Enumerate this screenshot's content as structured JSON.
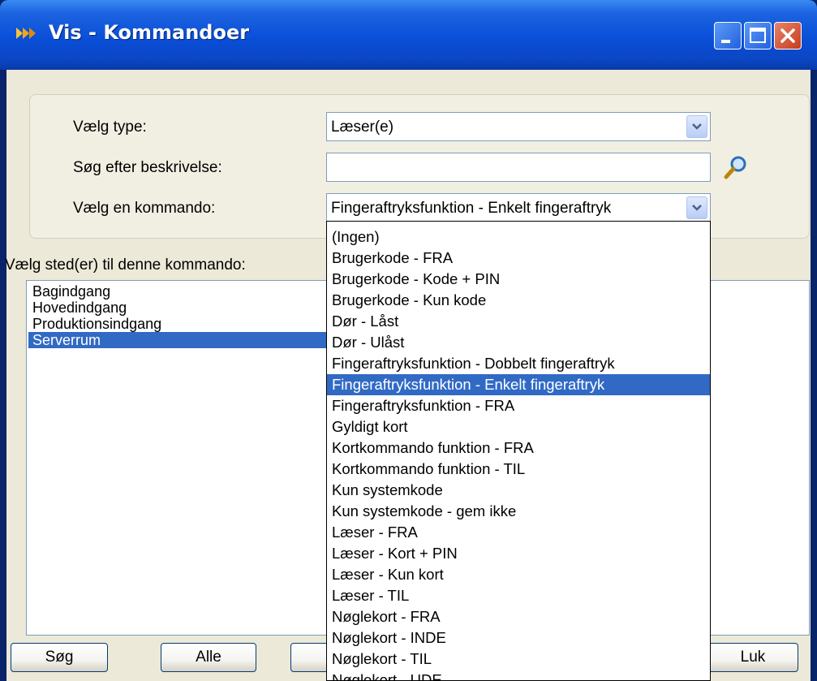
{
  "window": {
    "title": "Vis - Kommandoer",
    "buttons": [
      "minimize",
      "maximize",
      "close"
    ]
  },
  "filters": {
    "type_label": "Vælg type:",
    "type_value": "Læser(e)",
    "search_label": "Søg efter beskrivelse:",
    "search_value": "",
    "command_label": "Vælg en kommando:",
    "command_value": "Fingeraftryksfunktion - Enkelt fingeraftryk"
  },
  "locations": {
    "label": "Vælg sted(er) til denne kommando:",
    "items": [
      "Bagindgang",
      "Hovedindgang",
      "Produktionsindgang",
      "Serverrum"
    ],
    "selected_index": 3
  },
  "command_options": [
    "(Ingen)",
    "Brugerkode - FRA",
    "Brugerkode - Kode + PIN",
    "Brugerkode - Kun kode",
    "Dør - Låst",
    "Dør - Ulåst",
    "Fingeraftryksfunktion - Dobbelt fingeraftryk",
    "Fingeraftryksfunktion - Enkelt fingeraftryk",
    "Fingeraftryksfunktion - FRA",
    "Gyldigt kort",
    "Kortkommando funktion - FRA",
    "Kortkommando funktion - TIL",
    "Kun systemkode",
    "Kun systemkode - gem ikke",
    "Læser - FRA",
    "Læser - Kort + PIN",
    "Læser - Kun kort",
    "Læser - TIL",
    "Nøglekort - FRA",
    "Nøglekort - INDE",
    "Nøglekort - TIL",
    "Nøglekort - UDE"
  ],
  "command_selected_index": 7,
  "buttons": {
    "search": "Søg",
    "all": "Alle",
    "close": "Luk"
  },
  "colors": {
    "titlebar": "#0a4fd8",
    "selection": "#316ac5",
    "dialog_bg": "#ece9d8"
  }
}
